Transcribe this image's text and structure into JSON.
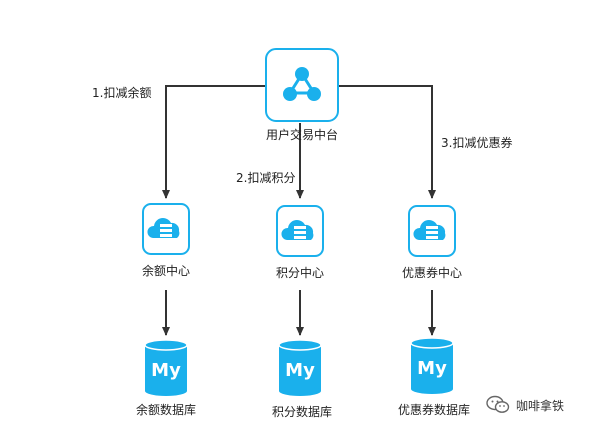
{
  "colors": {
    "accent": "#1ab0ec",
    "node_border": "#1ab0ec",
    "node_fill": "#ffffff",
    "line": "#333333",
    "db": "#1ab0ec",
    "text": "#222222"
  },
  "hub": {
    "label": "用户交易中台",
    "icon": "hub-network-icon"
  },
  "edges": [
    {
      "label": "1.扣减余额"
    },
    {
      "label": "2.扣减积分"
    },
    {
      "label": "3.扣减优惠券"
    }
  ],
  "services": [
    {
      "label": "余额中心",
      "icon": "cloud-server-icon"
    },
    {
      "label": "积分中心",
      "icon": "cloud-server-icon"
    },
    {
      "label": "优惠券中心",
      "icon": "cloud-server-icon"
    }
  ],
  "databases": [
    {
      "label": "余额数据库",
      "icon": "mysql-database-icon",
      "logo_text": "My"
    },
    {
      "label": "积分数据库",
      "icon": "mysql-database-icon",
      "logo_text": "My"
    },
    {
      "label": "优惠券数据库",
      "icon": "mysql-database-icon",
      "logo_text": "My"
    }
  ],
  "watermark": {
    "text": "咖啡拿铁",
    "icon": "wechat-icon"
  }
}
